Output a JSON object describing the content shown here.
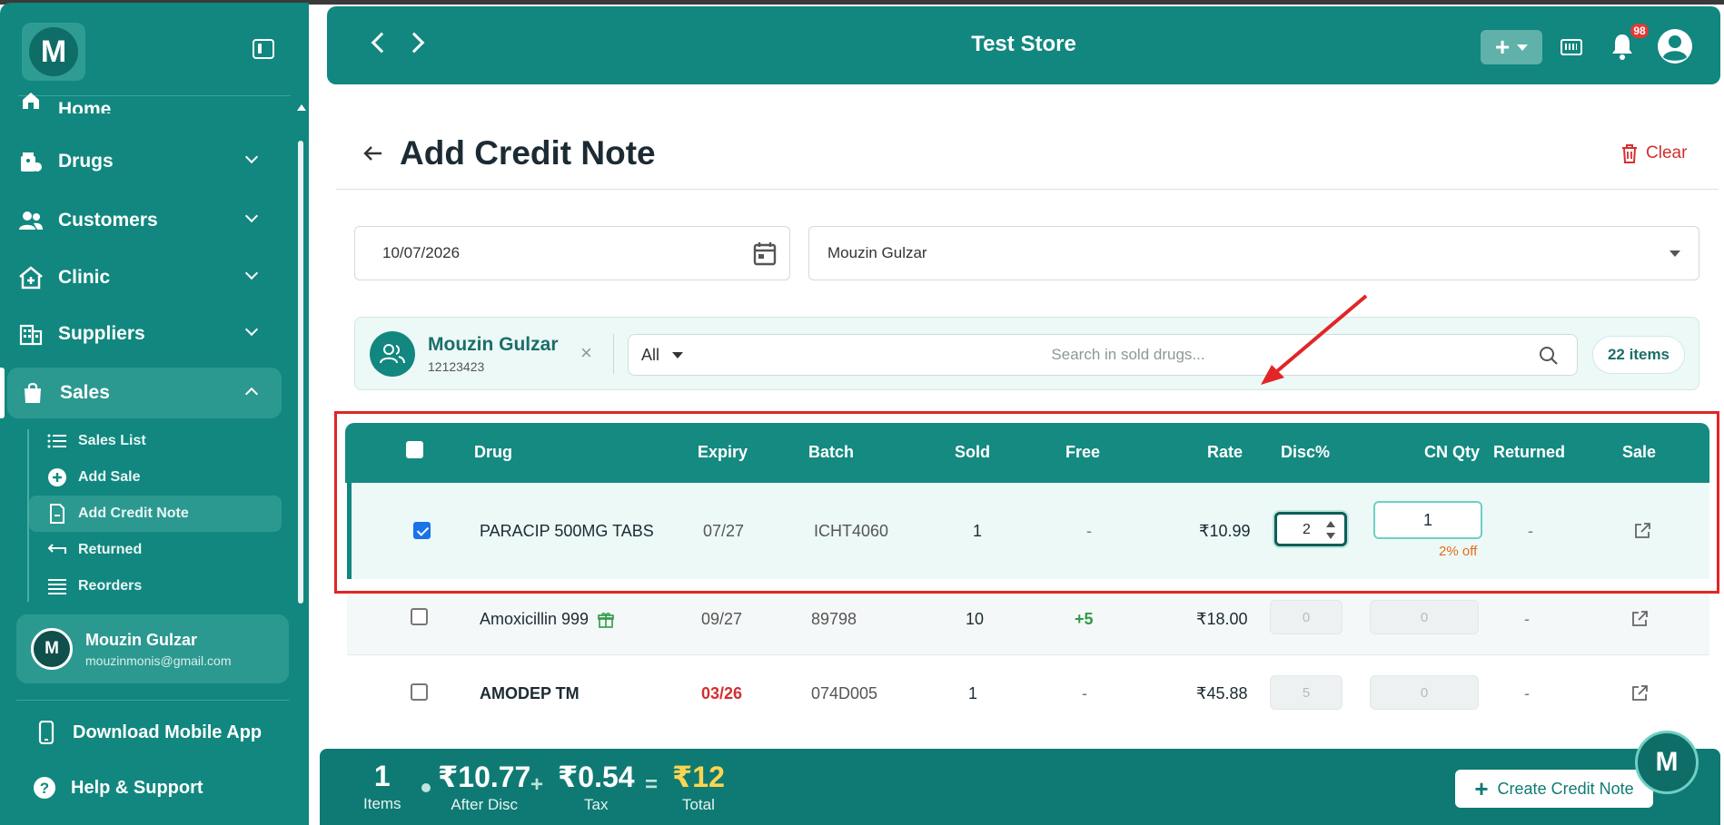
{
  "sidebar": {
    "logo_letter": "M",
    "nav": [
      {
        "label": "Home"
      },
      {
        "label": "Drugs"
      },
      {
        "label": "Customers"
      },
      {
        "label": "Clinic"
      },
      {
        "label": "Suppliers"
      },
      {
        "label": "Sales"
      }
    ],
    "sales_sub": [
      {
        "label": "Sales List"
      },
      {
        "label": "Add Sale"
      },
      {
        "label": "Add Credit Note"
      },
      {
        "label": "Returned"
      },
      {
        "label": "Reorders"
      }
    ],
    "user": {
      "initial": "M",
      "name": "Mouzin Gulzar",
      "email": "mouzinmonis@gmail.com"
    },
    "download_app": "Download Mobile App",
    "help": "Help & Support"
  },
  "header": {
    "title": "Test Store",
    "plus": "+",
    "notifications": "98"
  },
  "page": {
    "title": "Add Credit Note",
    "clear": "Clear",
    "date": "10/07/2026",
    "customer_select": "Mouzin Gulzar"
  },
  "customer": {
    "name": "Mouzin Gulzar",
    "phone": "12123423",
    "remove": "×"
  },
  "search": {
    "filter": "All",
    "placeholder": "Search in sold drugs...",
    "count": "22 items"
  },
  "table": {
    "headers": {
      "drug": "Drug",
      "expiry": "Expiry",
      "batch": "Batch",
      "sold": "Sold",
      "free": "Free",
      "rate": "Rate",
      "disc": "Disc%",
      "cnqty": "CN Qty",
      "returned": "Returned",
      "sale": "Sale"
    },
    "rows": [
      {
        "drug": "PARACIP 500MG TABS",
        "expiry": "07/27",
        "batch": "ICHT4060",
        "sold": "1",
        "free": "-",
        "rate": "₹10.99",
        "disc": "2",
        "cnqty": "1",
        "off": "2% off",
        "returned": "-",
        "checked": true
      },
      {
        "drug": "Amoxicillin 999",
        "expiry": "09/27",
        "batch": "89798",
        "sold": "10",
        "free": "+5",
        "rate": "₹18.00",
        "disc": "0",
        "cnqty": "0",
        "returned": "-",
        "checked": false
      },
      {
        "drug": "AMODEP TM",
        "expiry": "03/26",
        "batch": "074D005",
        "sold": "1",
        "free": "-",
        "rate": "₹45.88",
        "disc": "5",
        "cnqty": "0",
        "returned": "-",
        "checked": false
      }
    ]
  },
  "footer": {
    "items": "1",
    "items_label": "Items",
    "after_disc": "₹10.77",
    "after_disc_label": "After Disc",
    "plus": "+",
    "tax": "₹0.54",
    "tax_label": "Tax",
    "equals": "=",
    "total": "₹12",
    "total_label": "Total",
    "create": "Create Credit Note"
  },
  "fab_letter": "M",
  "colors": {
    "brand": "#11877f",
    "danger": "#d32f2f",
    "total": "#ffd54f",
    "accent_blue": "#1a73e8"
  }
}
